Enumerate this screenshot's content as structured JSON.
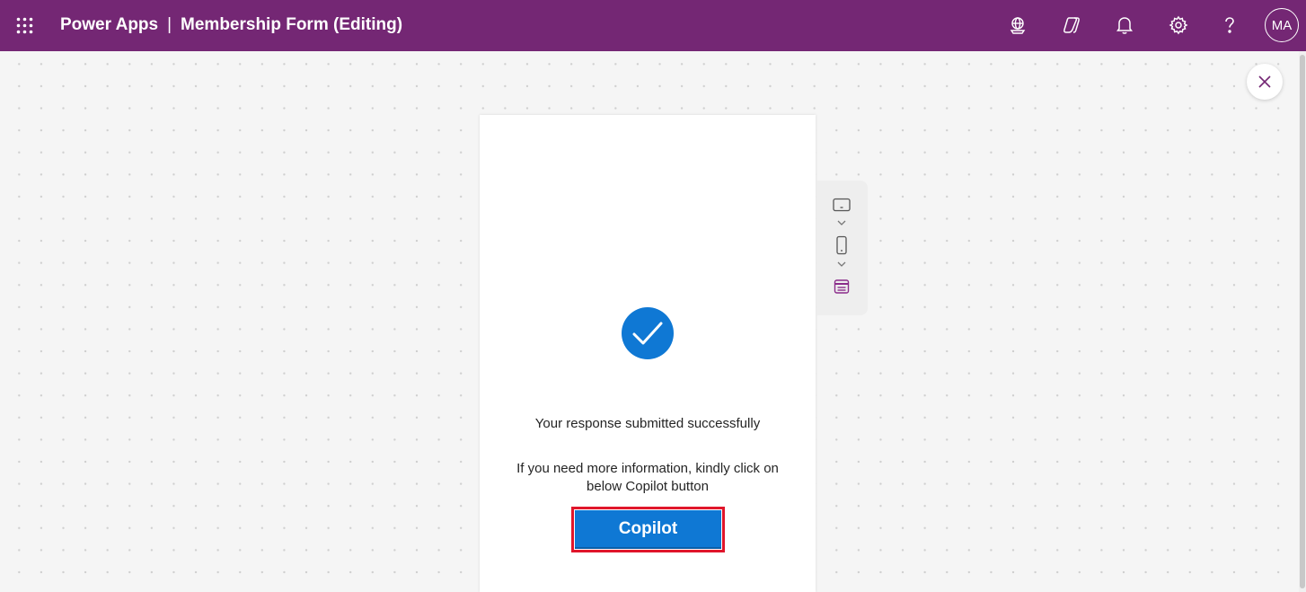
{
  "header": {
    "app_name": "Power Apps",
    "separator": "|",
    "form_title": "Membership Form (Editing)",
    "avatar_initials": "MA",
    "icons": [
      "waffle-icon",
      "environment-icon",
      "copilot-icon",
      "notifications-icon",
      "settings-icon",
      "help-icon"
    ]
  },
  "form": {
    "success_message": "Your response submitted successfully",
    "info_message": "If you need more information, kindly click on below Copilot button",
    "copilot_button_label": "Copilot",
    "status_icon": "checkmark-circle-icon"
  },
  "device_toolbar": {
    "icons": [
      "tablet-icon",
      "phone-icon",
      "web-icon"
    ]
  },
  "colors": {
    "header_bg": "#742774",
    "accent_blue": "#0f78d4",
    "highlight_red": "#e0162b",
    "web_icon": "#8a2c8a"
  }
}
